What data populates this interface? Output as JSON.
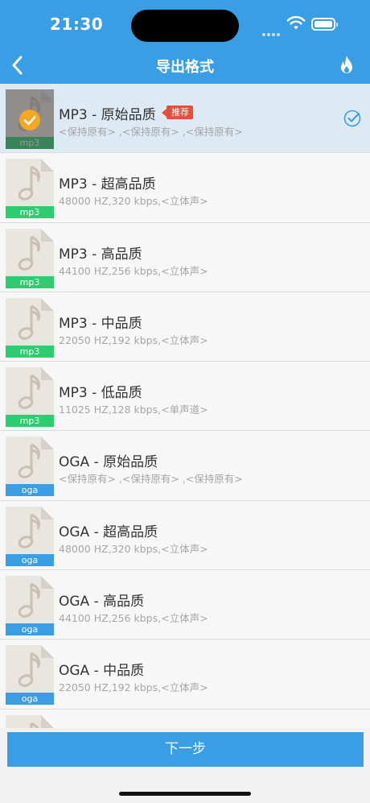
{
  "status_bar": {
    "time": "21:30"
  },
  "header": {
    "title": "导出格式"
  },
  "recommend_tag": "推荐",
  "formats": [
    {
      "title": "MP3 - 原始品质",
      "subtitle": "<保持原有> ,<保持原有> ,<保持原有>",
      "badge": "mp3",
      "selected": true,
      "recommended": true
    },
    {
      "title": "MP3 - 超高品质",
      "subtitle": "48000 HZ,320 kbps,<立体声>",
      "badge": "mp3",
      "selected": false
    },
    {
      "title": "MP3 - 高品质",
      "subtitle": "44100 HZ,256 kbps,<立体声>",
      "badge": "mp3",
      "selected": false
    },
    {
      "title": "MP3 - 中品质",
      "subtitle": "22050 HZ,192 kbps,<立体声>",
      "badge": "mp3",
      "selected": false
    },
    {
      "title": "MP3 - 低品质",
      "subtitle": "11025 HZ,128 kbps,<单声道>",
      "badge": "mp3",
      "selected": false
    },
    {
      "title": "OGA - 原始品质",
      "subtitle": "<保持原有> ,<保持原有> ,<保持原有>",
      "badge": "oga",
      "selected": false
    },
    {
      "title": "OGA - 超高品质",
      "subtitle": "48000 HZ,320 kbps,<立体声>",
      "badge": "oga",
      "selected": false
    },
    {
      "title": "OGA - 高品质",
      "subtitle": "44100 HZ,256 kbps,<立体声>",
      "badge": "oga",
      "selected": false
    },
    {
      "title": "OGA - 中品质",
      "subtitle": "22050 HZ,192 kbps,<立体声>",
      "badge": "oga",
      "selected": false
    },
    {
      "title": "",
      "subtitle": "",
      "badge": "",
      "selected": false
    }
  ],
  "footer": {
    "next_label": "下一步"
  },
  "colors": {
    "accent": "#3a9ee4",
    "mp3_badge": "#2ecc71",
    "oga_badge": "#3a9ee4",
    "selected_check": "#f5a623",
    "recommend": "#e74c3c"
  }
}
